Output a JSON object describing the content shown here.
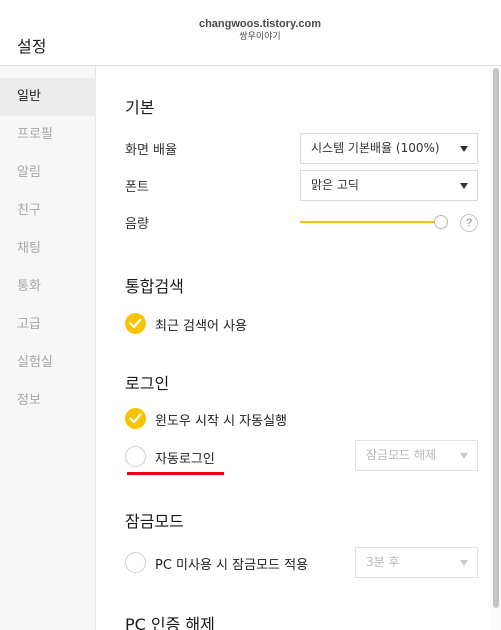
{
  "window": {
    "title": "설정"
  },
  "watermark": {
    "line1": "changwoos.tistory.com",
    "line2": "쌍우이야기"
  },
  "sidebar": {
    "items": [
      {
        "label": "일반",
        "active": true
      },
      {
        "label": "프로필"
      },
      {
        "label": "알림"
      },
      {
        "label": "친구"
      },
      {
        "label": "채팅"
      },
      {
        "label": "통화"
      },
      {
        "label": "고급"
      },
      {
        "label": "실험실"
      },
      {
        "label": "정보"
      }
    ]
  },
  "basic": {
    "title": "기본",
    "display_scale_label": "화면 배율",
    "display_scale_value": "시스템 기본배율 (100%)",
    "font_label": "폰트",
    "font_value": "맑은 고딕",
    "volume_label": "음량",
    "volume_level": 1.0,
    "help_glyph": "?"
  },
  "search": {
    "title": "통합검색",
    "recent_keywords_label": "최근 검색어 사용",
    "recent_keywords_checked": true
  },
  "login": {
    "title": "로그인",
    "autostart_label": "윈도우 시작 시 자동실행",
    "autostart_checked": true,
    "autologin_label": "자동로그인",
    "autologin_checked": false,
    "autologin_select_value": "잠금모드 해제"
  },
  "lockmode": {
    "title": "잠금모드",
    "idle_lock_label": "PC 미사용 시 잠금모드 적용",
    "idle_lock_checked": false,
    "idle_select_value": "3분 후"
  },
  "pc_auth": {
    "title": "PC 인증 해제"
  },
  "colors": {
    "accent": "#f8c400",
    "highlight_underline": "#e60012"
  },
  "icons": {
    "check": "check-icon",
    "dropdown": "chevron-down-icon",
    "help": "help-icon"
  }
}
